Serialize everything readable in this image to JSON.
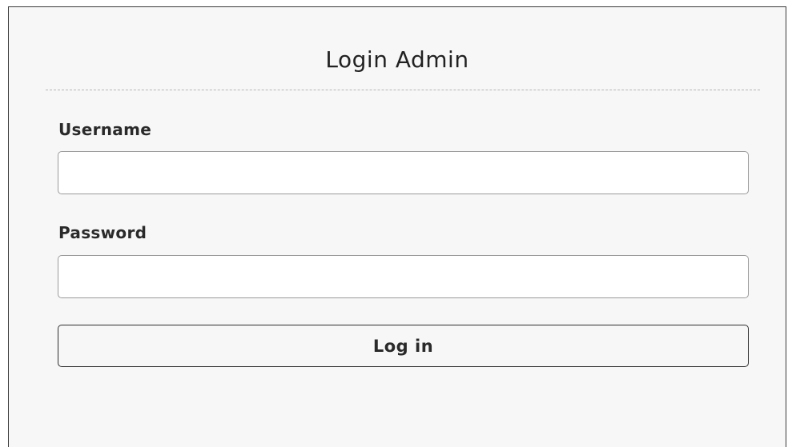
{
  "form": {
    "title": "Login Admin",
    "username_label": "Username",
    "username_value": "",
    "password_label": "Password",
    "password_value": "",
    "submit_label": "Log in"
  }
}
